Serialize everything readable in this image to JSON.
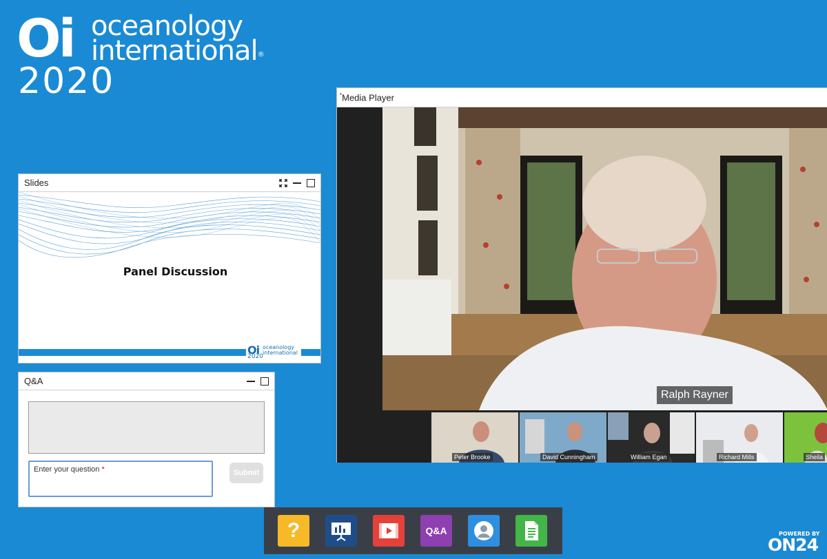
{
  "logo": {
    "mark": "Oi",
    "line1": "oceanology",
    "line2": "international",
    "registered": "®",
    "year": "2020"
  },
  "slides": {
    "title": "Slides",
    "slide_heading": "Panel Discussion",
    "slide_logo": {
      "mark": "Oi",
      "line1": "oceanology",
      "line2": "international",
      "year": "2020"
    }
  },
  "qa": {
    "title": "Q&A",
    "input_placeholder": "Enter your question",
    "required_marker": "*",
    "submit_label": "Submit"
  },
  "media": {
    "title": "Media Player",
    "title_marker": "*",
    "speaker": "Ralph Rayner",
    "participants": [
      "Peter Brooke",
      "David Cunningham",
      "William Egan",
      "Richard Mills",
      "Sheila"
    ]
  },
  "toolbar": {
    "help_glyph": "?",
    "qa_label": "Q&A",
    "colors": {
      "help": "#f7b928",
      "slides": "#1f4d8a",
      "media": "#e4413b",
      "qa": "#8e3fb0",
      "speaker": "#2e8fe0",
      "resources": "#44b549"
    }
  },
  "branding": {
    "powered": "POWERED BY",
    "name": "ON24"
  }
}
